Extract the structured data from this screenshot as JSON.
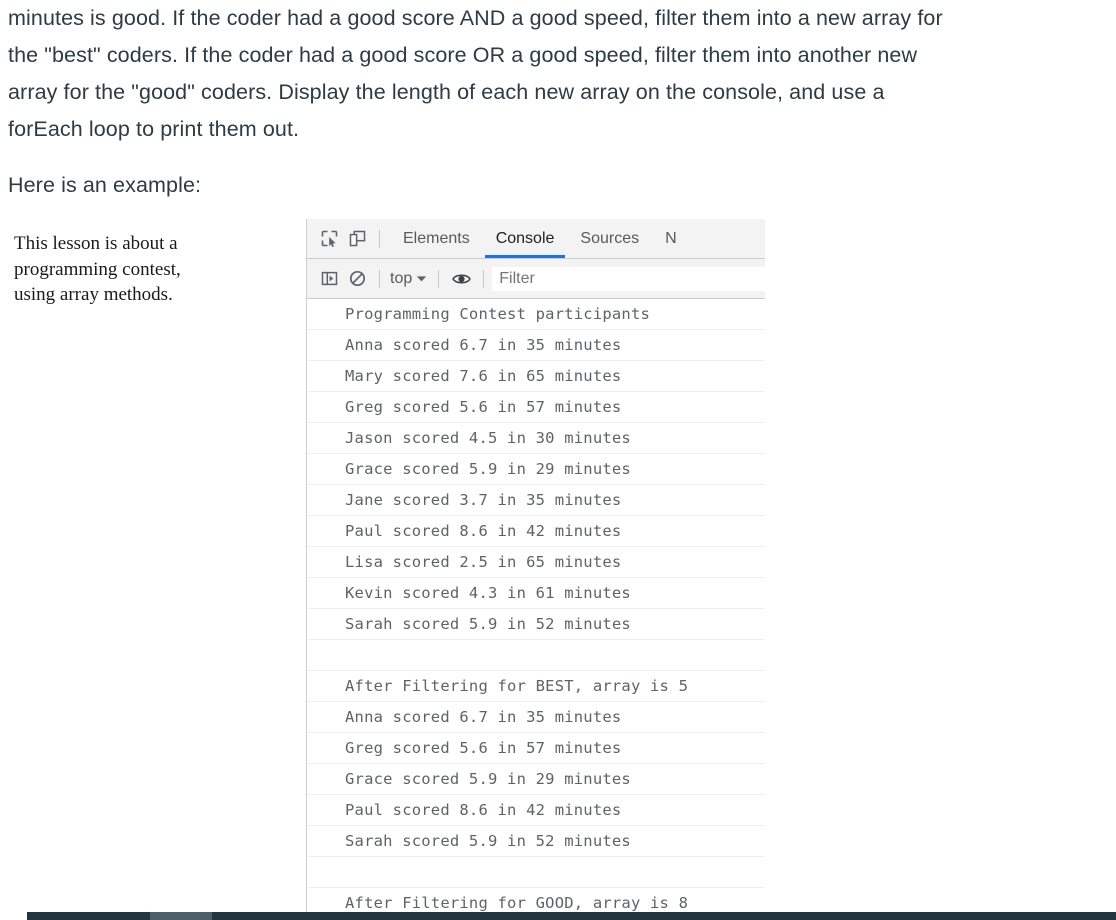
{
  "lesson": {
    "paragraph_1": "minutes is good. If the coder had a good score AND a good speed, filter them into a new array for the \"best\" coders. If the coder had a good score OR a good speed, filter them into another new array for the \"good\" coders. Display the length of each new array on the console, and use a forEach loop to print them out.",
    "paragraph_2": "Here is an example:"
  },
  "annotation": {
    "line_1": "This lesson is about a",
    "line_2": "programming contest,",
    "line_3": "using array methods."
  },
  "devtools": {
    "toolbar": {
      "inspect_icon": "inspect-element-icon",
      "device_icon": "device-toolbar-icon",
      "tabs": [
        {
          "label": "Elements",
          "active": false
        },
        {
          "label": "Console",
          "active": true
        },
        {
          "label": "Sources",
          "active": false
        },
        {
          "label": "N",
          "active": false
        }
      ]
    },
    "filterbar": {
      "sidebar_icon": "console-sidebar-icon",
      "clear_icon": "clear-console-icon",
      "context": "top",
      "caret_icon": "chevron-down-icon",
      "eye_icon": "live-expression-eye-icon",
      "filter_placeholder": "Filter"
    },
    "console_lines": [
      "Programming Contest participants",
      "Anna scored 6.7 in 35 minutes",
      "Mary scored 7.6 in 65 minutes",
      "Greg scored 5.6 in 57 minutes",
      "Jason scored 4.5 in 30 minutes",
      "Grace scored 5.9 in 29 minutes",
      "Jane scored 3.7 in 35 minutes",
      "Paul scored 8.6 in 42 minutes",
      "Lisa scored 2.5 in 65 minutes",
      "Kevin scored 4.3 in 61 minutes",
      "Sarah scored 5.9 in 52 minutes",
      "",
      "After Filtering for BEST, array is 5",
      "Anna scored 6.7 in 35 minutes",
      "Greg scored 5.6 in 57 minutes",
      "Grace scored 5.9 in 29 minutes",
      "Paul scored 8.6 in 42 minutes",
      "Sarah scored 5.9 in 52 minutes",
      "",
      "After Filtering for GOOD, array is 8"
    ]
  },
  "colors": {
    "accent_blue": "#1a73e8",
    "prose_text": "#2d3b45",
    "console_text": "#5f6368",
    "toolbar_bg": "#f3f3f3",
    "scrollbar_track": "#24353f",
    "scrollbar_thumb": "#4c5f69"
  }
}
